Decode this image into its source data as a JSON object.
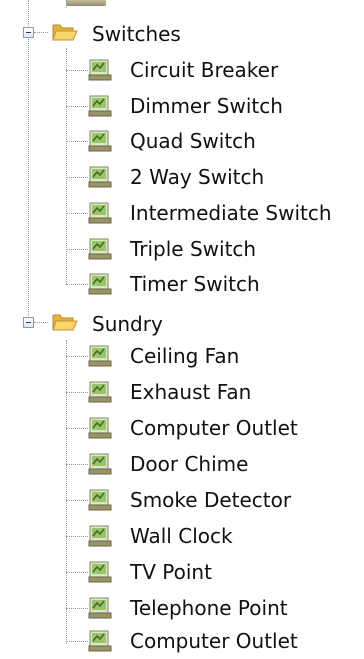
{
  "tree": {
    "groups": [
      {
        "label": "Switches",
        "icon": "open-folder-icon",
        "expanded": true,
        "items": [
          {
            "label": "Circuit Breaker",
            "icon": "component-icon"
          },
          {
            "label": "Dimmer Switch",
            "icon": "component-icon"
          },
          {
            "label": "Quad Switch",
            "icon": "component-icon"
          },
          {
            "label": "2 Way Switch",
            "icon": "component-icon"
          },
          {
            "label": "Intermediate Switch",
            "icon": "component-icon"
          },
          {
            "label": "Triple Switch",
            "icon": "component-icon"
          },
          {
            "label": "Timer Switch",
            "icon": "component-icon"
          }
        ]
      },
      {
        "label": "Sundry",
        "icon": "open-folder-icon",
        "expanded": true,
        "items": [
          {
            "label": "Ceiling Fan",
            "icon": "component-icon"
          },
          {
            "label": "Exhaust Fan",
            "icon": "component-icon"
          },
          {
            "label": "Computer Outlet",
            "icon": "component-icon"
          },
          {
            "label": "Door Chime",
            "icon": "component-icon"
          },
          {
            "label": "Smoke Detector",
            "icon": "component-icon"
          },
          {
            "label": "Wall Clock",
            "icon": "component-icon"
          },
          {
            "label": "TV Point",
            "icon": "component-icon"
          },
          {
            "label": "Telephone Point",
            "icon": "component-icon"
          },
          {
            "label": "Computer Outlet",
            "icon": "component-icon"
          }
        ]
      }
    ]
  },
  "colors": {
    "folder": "#f2c94c",
    "icon_screen": "#8bc34a",
    "line": "#9a9a9a"
  }
}
